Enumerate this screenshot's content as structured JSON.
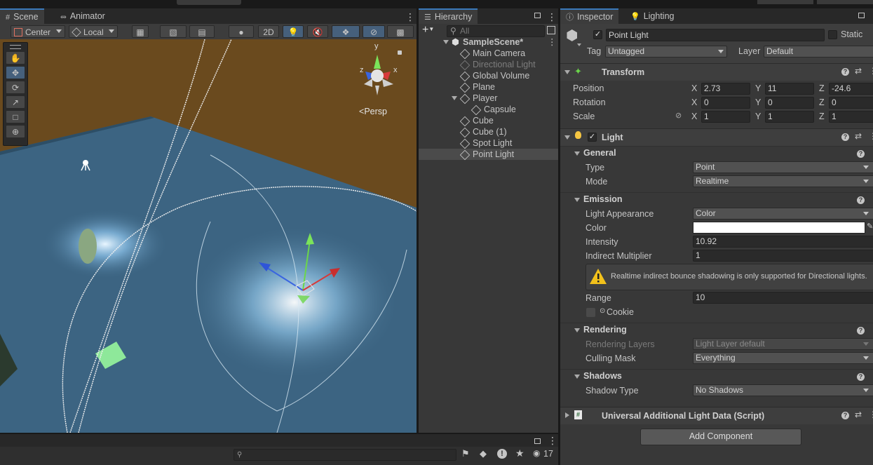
{
  "scene": {
    "tabs": [
      {
        "label": "Scene",
        "icon": "grid-icon"
      },
      {
        "label": "Animator",
        "icon": "animator-icon"
      }
    ],
    "toolbar": {
      "pivot": "Center",
      "space": "Local",
      "mode2d": "2D"
    },
    "gizmo": {
      "projection": "Persp",
      "axes": {
        "x": "x",
        "y": "y",
        "z": "z"
      }
    }
  },
  "hierarchy": {
    "title": "Hierarchy",
    "search_placeholder": "All",
    "scene_name": "SampleScene*",
    "items": [
      {
        "label": "Main Camera",
        "depth": 1,
        "disabled": false,
        "selected": false
      },
      {
        "label": "Directional Light",
        "depth": 1,
        "disabled": true,
        "selected": false
      },
      {
        "label": "Global Volume",
        "depth": 1,
        "disabled": false,
        "selected": false
      },
      {
        "label": "Plane",
        "depth": 1,
        "disabled": false,
        "selected": false
      },
      {
        "label": "Player",
        "depth": 1,
        "disabled": false,
        "selected": false,
        "expanded": true
      },
      {
        "label": "Capsule",
        "depth": 2,
        "disabled": false,
        "selected": false
      },
      {
        "label": "Cube",
        "depth": 1,
        "disabled": false,
        "selected": false
      },
      {
        "label": "Cube (1)",
        "depth": 1,
        "disabled": false,
        "selected": false
      },
      {
        "label": "Spot Light",
        "depth": 1,
        "disabled": false,
        "selected": false
      },
      {
        "label": "Point Light",
        "depth": 1,
        "disabled": false,
        "selected": true
      }
    ]
  },
  "inspector": {
    "tabs": [
      {
        "label": "Inspector"
      },
      {
        "label": "Lighting"
      }
    ],
    "object": {
      "name": "Point Light",
      "static_label": "Static",
      "tag_label": "Tag",
      "tag": "Untagged",
      "layer_label": "Layer",
      "layer": "Default"
    },
    "transform": {
      "title": "Transform",
      "position": {
        "label": "Position",
        "x": "2.73",
        "y": "11",
        "z": "-24.6"
      },
      "rotation": {
        "label": "Rotation",
        "x": "0",
        "y": "0",
        "z": "0"
      },
      "scale": {
        "label": "Scale",
        "x": "1",
        "y": "1",
        "z": "1"
      },
      "axis": {
        "x": "X",
        "y": "Y",
        "z": "Z"
      }
    },
    "light": {
      "title": "Light",
      "general": {
        "title": "General",
        "type_label": "Type",
        "type": "Point",
        "mode_label": "Mode",
        "mode": "Realtime"
      },
      "emission": {
        "title": "Emission",
        "appearance_label": "Light Appearance",
        "appearance": "Color",
        "color_label": "Color",
        "color_value": "#ffffff",
        "intensity_label": "Intensity",
        "intensity": "10.92",
        "indirect_label": "Indirect Multiplier",
        "indirect": "1",
        "warning": "Realtime indirect bounce shadowing is only supported for Directional lights.",
        "range_label": "Range",
        "range": "10",
        "cookie_label": "Cookie"
      },
      "rendering": {
        "title": "Rendering",
        "layers_label": "Rendering Layers",
        "layers": "Light Layer default",
        "culling_label": "Culling Mask",
        "culling": "Everything"
      },
      "shadows": {
        "title": "Shadows",
        "type_label": "Shadow Type",
        "type": "No Shadows"
      }
    },
    "urp": {
      "title": "Universal Additional Light Data (Script)"
    },
    "add_component": "Add Component"
  },
  "console": {
    "count": "17"
  },
  "colors": {
    "accent": "#3a79bb",
    "panel": "#383838",
    "selection": "#4b4b4b"
  }
}
